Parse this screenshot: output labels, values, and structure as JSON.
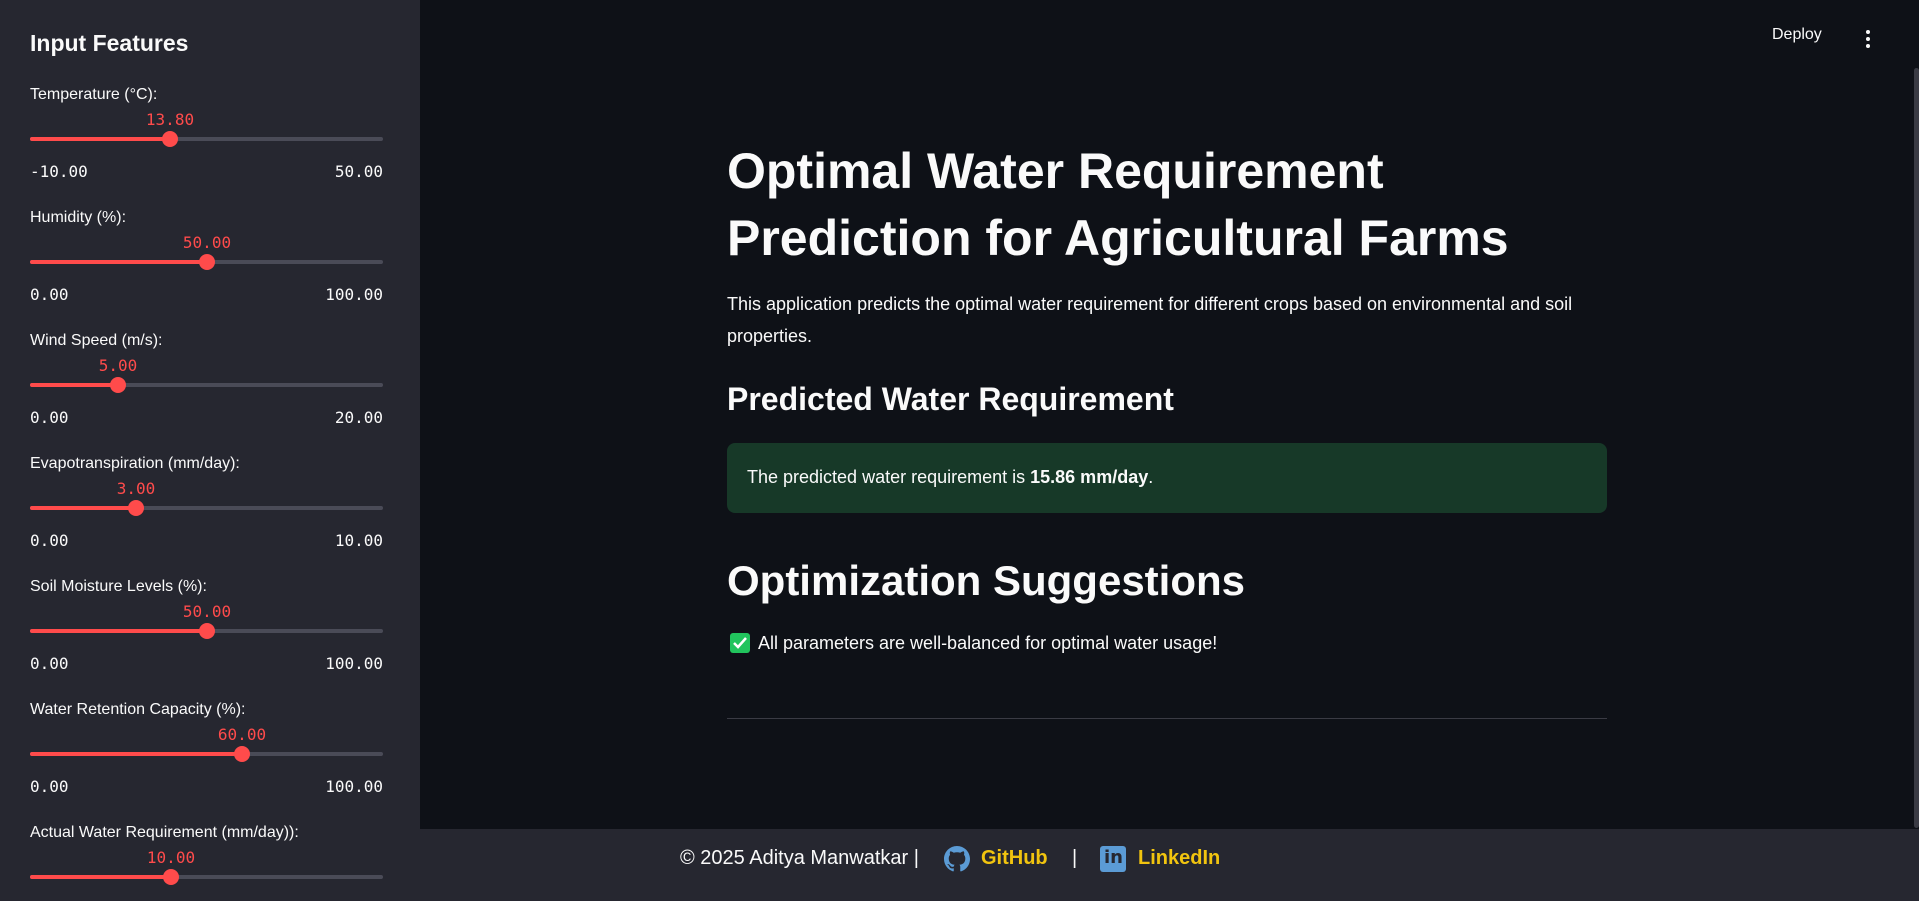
{
  "sidebar": {
    "title": "Input Features",
    "sliders": [
      {
        "label": "Temperature (°C):",
        "value": "13.80",
        "min": "-10.00",
        "max": "50.00",
        "fraction": 0.397
      },
      {
        "label": "Humidity (%):",
        "value": "50.00",
        "min": "0.00",
        "max": "100.00",
        "fraction": 0.5
      },
      {
        "label": "Wind Speed (m/s):",
        "value": "5.00",
        "min": "0.00",
        "max": "20.00",
        "fraction": 0.25
      },
      {
        "label": "Evapotranspiration (mm/day):",
        "value": "3.00",
        "min": "0.00",
        "max": "10.00",
        "fraction": 0.3
      },
      {
        "label": "Soil Moisture Levels (%):",
        "value": "50.00",
        "min": "0.00",
        "max": "100.00",
        "fraction": 0.5
      },
      {
        "label": "Water Retention Capacity (%):",
        "value": "60.00",
        "min": "0.00",
        "max": "100.00",
        "fraction": 0.6
      },
      {
        "label": "Actual Water Requirement (mm/day)):",
        "value": "10.00",
        "min": "",
        "max": "",
        "fraction": 0.4
      }
    ]
  },
  "topbar": {
    "deploy_label": "Deploy"
  },
  "main": {
    "title": "Optimal Water Requirement Prediction for Agricultural Farms",
    "description": "This application predicts the optimal water requirement for different crops based on environmental and soil properties.",
    "prediction_header": "Predicted Water Requirement",
    "prediction_prefix": "The predicted water requirement is ",
    "prediction_value": "15.86 mm/day",
    "prediction_suffix": ".",
    "suggestions_header": "Optimization Suggestions",
    "suggestion_text": "All parameters are well-balanced for optimal water usage!"
  },
  "footer": {
    "copyright": "© 2025 Aditya Manwatkar |",
    "github_label": "GitHub",
    "separator": "|",
    "linkedin_label": "LinkedIn"
  },
  "colors": {
    "accent": "#ff4b4b",
    "success_bg": "#173928",
    "link": "#f1c40f"
  }
}
